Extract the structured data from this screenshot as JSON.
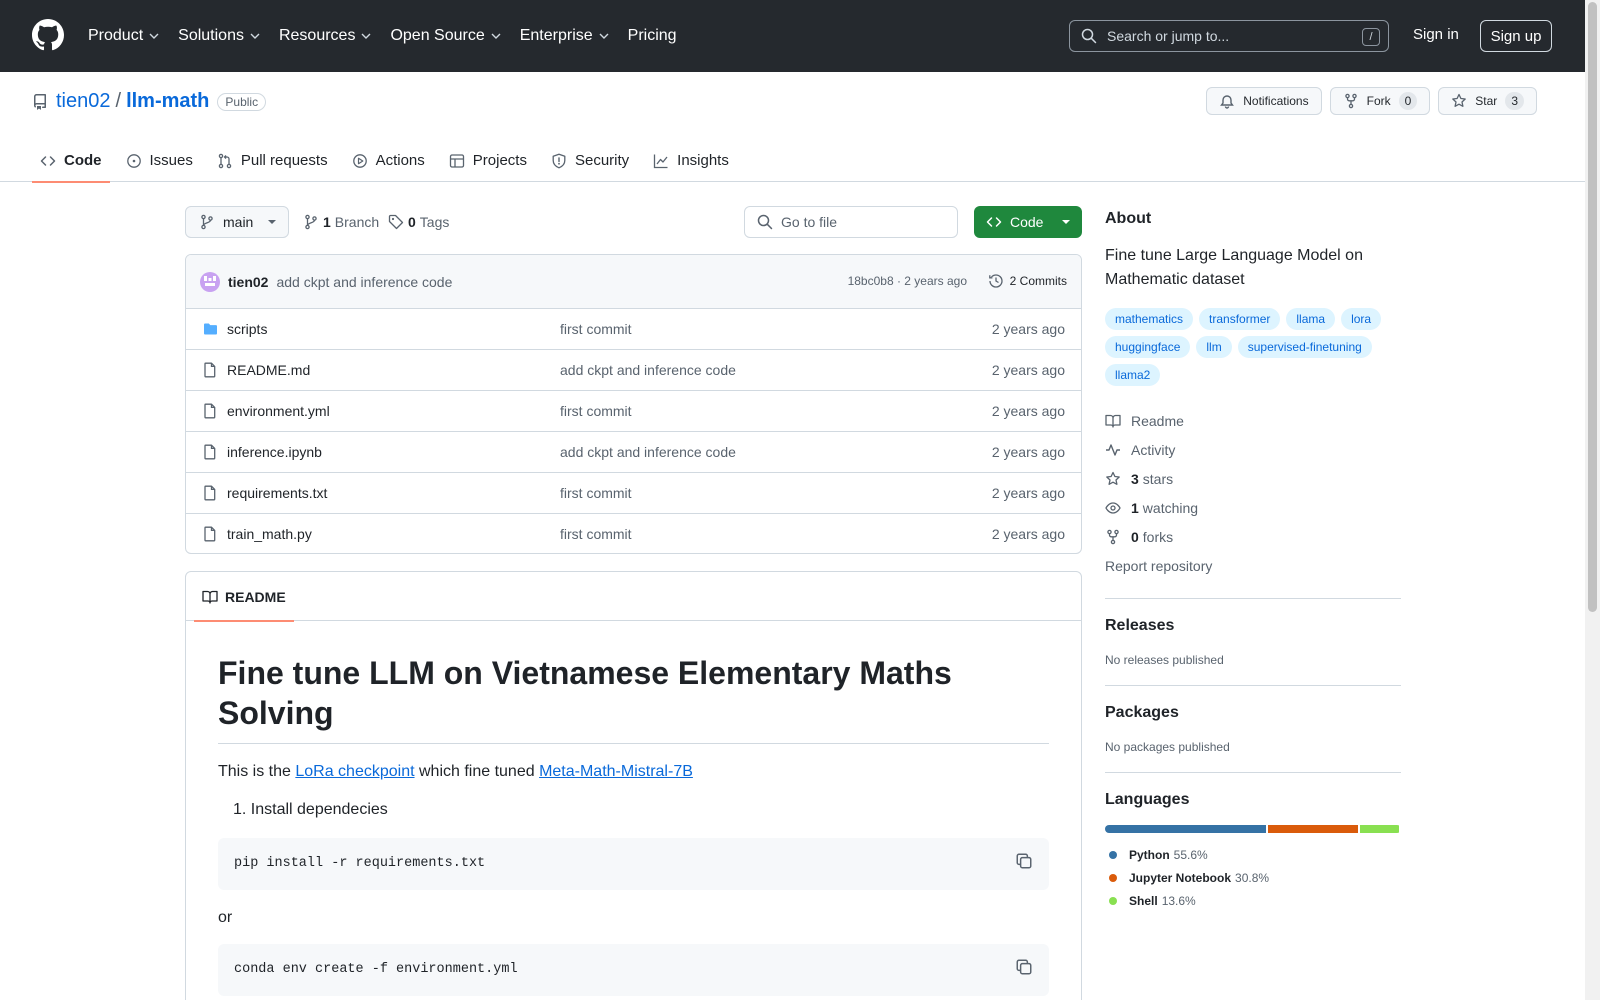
{
  "header": {
    "nav": [
      "Product",
      "Solutions",
      "Resources",
      "Open Source",
      "Enterprise",
      "Pricing"
    ],
    "nav_has_chevron": [
      true,
      true,
      true,
      true,
      true,
      false
    ],
    "search_placeholder": "Search or jump to...",
    "search_shortcut": "/",
    "signin": "Sign in",
    "signup": "Sign up"
  },
  "repo": {
    "owner": "tien02",
    "separator": "/",
    "name": "llm-math",
    "visibility": "Public",
    "notifications_label": "Notifications",
    "fork_label": "Fork",
    "fork_count": "0",
    "star_label": "Star",
    "star_count": "3"
  },
  "tabs": [
    {
      "label": "Code",
      "icon": "code-icon",
      "active": true
    },
    {
      "label": "Issues",
      "icon": "issue-icon",
      "active": false
    },
    {
      "label": "Pull requests",
      "icon": "pull-request-icon",
      "active": false
    },
    {
      "label": "Actions",
      "icon": "play-icon",
      "active": false
    },
    {
      "label": "Projects",
      "icon": "table-icon",
      "active": false
    },
    {
      "label": "Security",
      "icon": "shield-icon",
      "active": false
    },
    {
      "label": "Insights",
      "icon": "graph-icon",
      "active": false
    }
  ],
  "branchbar": {
    "branch": "main",
    "branch_count": "1",
    "branch_label": "Branch",
    "tag_count": "0",
    "tag_label": "Tags",
    "goto_placeholder": "Go to file",
    "code_label": "Code"
  },
  "commit": {
    "author": "tien02",
    "message": "add ckpt and inference code",
    "meta": "18bc0b8 · 2 years ago",
    "count_label": "2 Commits"
  },
  "files": [
    {
      "name": "scripts",
      "type": "folder",
      "message": "first commit",
      "age": "2 years ago"
    },
    {
      "name": "README.md",
      "type": "file",
      "message": "add ckpt and inference code",
      "age": "2 years ago"
    },
    {
      "name": "environment.yml",
      "type": "file",
      "message": "first commit",
      "age": "2 years ago"
    },
    {
      "name": "inference.ipynb",
      "type": "file",
      "message": "add ckpt and inference code",
      "age": "2 years ago"
    },
    {
      "name": "requirements.txt",
      "type": "file",
      "message": "first commit",
      "age": "2 years ago"
    },
    {
      "name": "train_math.py",
      "type": "file",
      "message": "first commit",
      "age": "2 years ago"
    }
  ],
  "readme": {
    "tab_label": "README",
    "title": "Fine tune LLM on Vietnamese Elementary Maths Solving",
    "intro_prefix": "This is the ",
    "link1": "LoRa checkpoint",
    "intro_mid": " which fine tuned ",
    "link2": "Meta-Math-Mistral-7B",
    "step1": "1. Install dependecies",
    "code1": "pip install -r requirements.txt",
    "or": "or",
    "code2": "conda env create -f environment.yml"
  },
  "about": {
    "heading": "About",
    "description": "Fine tune Large Language Model on Mathematic dataset",
    "topics": [
      "mathematics",
      "transformer",
      "llama",
      "lora",
      "huggingface",
      "llm",
      "supervised-finetuning",
      "llama2"
    ],
    "readme": "Readme",
    "activity": "Activity",
    "stars_n": "3",
    "stars": "stars",
    "watching_n": "1",
    "watching": "watching",
    "forks_n": "0",
    "forks": "forks",
    "report": "Report repository"
  },
  "releases": {
    "heading": "Releases",
    "empty": "No releases published"
  },
  "packages": {
    "heading": "Packages",
    "empty": "No packages published"
  },
  "languages": {
    "heading": "Languages",
    "items": [
      {
        "name": "Python",
        "percent": "55.6%",
        "value": 55.6,
        "color": "#3572A5"
      },
      {
        "name": "Jupyter Notebook",
        "percent": "30.8%",
        "value": 30.8,
        "color": "#DA5B0B"
      },
      {
        "name": "Shell",
        "percent": "13.6%",
        "value": 13.6,
        "color": "#89e051"
      }
    ]
  }
}
